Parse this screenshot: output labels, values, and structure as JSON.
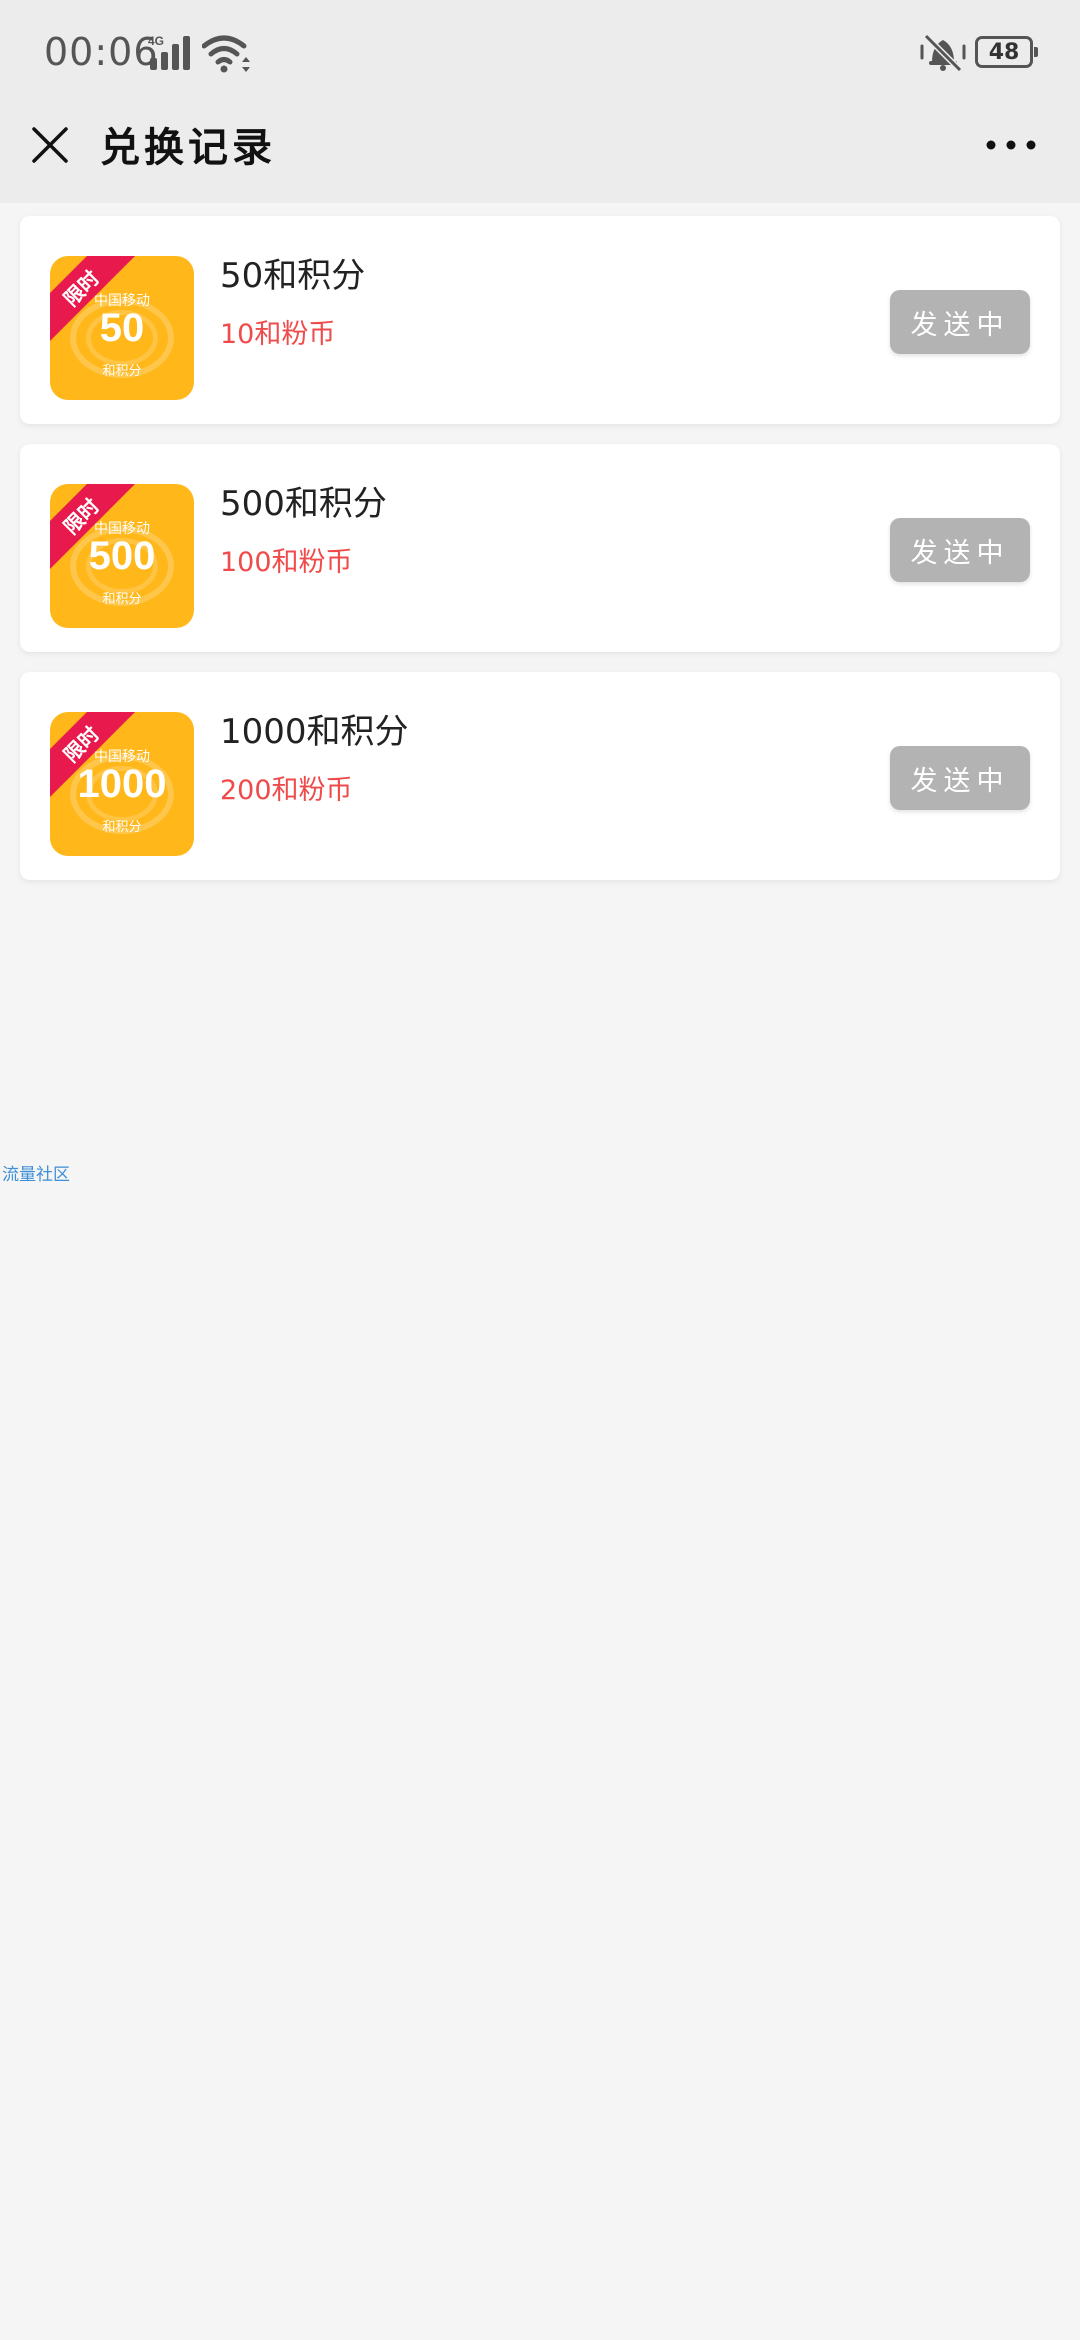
{
  "status": {
    "time": "00:06",
    "network": "4G",
    "battery": "48"
  },
  "nav": {
    "title": "兑换记录"
  },
  "items": [
    {
      "badge": "限时",
      "brand": "中国移动",
      "amount": "50",
      "unit": "和积分",
      "title": "50和积分",
      "price": "10和粉币",
      "status": "发送中"
    },
    {
      "badge": "限时",
      "brand": "中国移动",
      "amount": "500",
      "unit": "和积分",
      "title": "500和积分",
      "price": "100和粉币",
      "status": "发送中"
    },
    {
      "badge": "限时",
      "brand": "中国移动",
      "amount": "1000",
      "unit": "和积分",
      "title": "1000和积分",
      "price": "200和粉币",
      "status": "发送中"
    }
  ],
  "footer": {
    "link": "流量社区"
  }
}
